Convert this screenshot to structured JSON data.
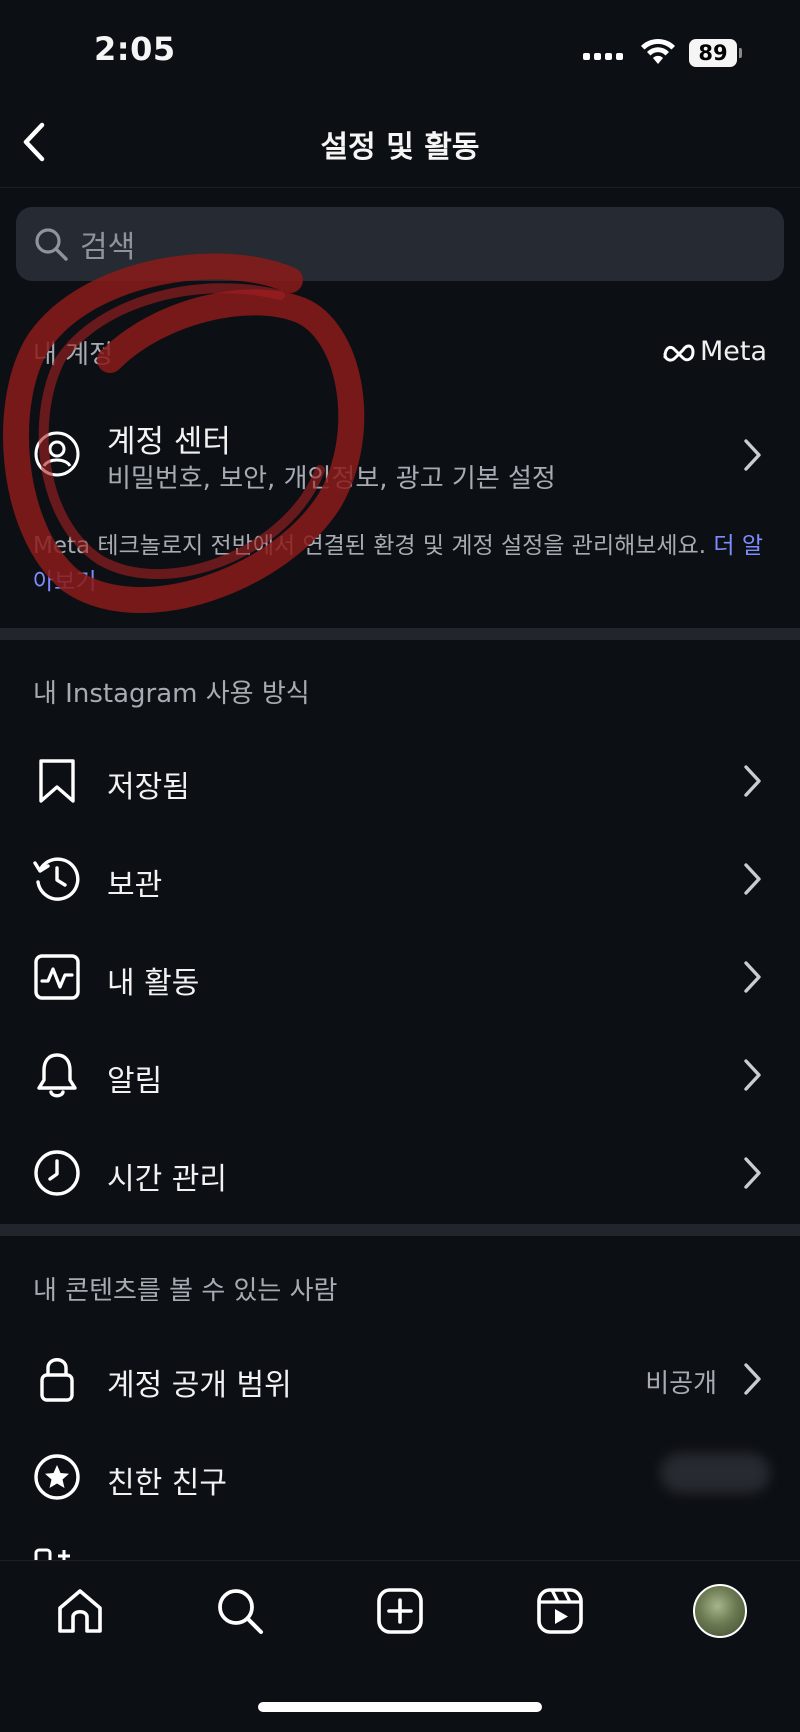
{
  "status": {
    "time": "2:05",
    "battery": "89"
  },
  "header": {
    "title": "설정 및 활동"
  },
  "search": {
    "placeholder": "검색"
  },
  "account_section": {
    "label": "내 계정",
    "brand": "Meta",
    "center": {
      "title": "계정 센터",
      "subtitle": "비밀번호, 보안, 개인정보, 광고 기본 설정"
    },
    "description": "Meta 테크놀로지 전반에서 연결된 환경 및 계정 설정을 관리해보세요.",
    "learn_more": "더 알아보기"
  },
  "usage_section": {
    "label": "내 Instagram 사용 방식",
    "items": [
      {
        "label": "저장됨",
        "icon": "bookmark-icon"
      },
      {
        "label": "보관",
        "icon": "archive-history-icon"
      },
      {
        "label": "내 활동",
        "icon": "activity-icon"
      },
      {
        "label": "알림",
        "icon": "bell-icon"
      },
      {
        "label": "시간 관리",
        "icon": "clock-icon"
      }
    ]
  },
  "content_section": {
    "label": "내 콘텐츠를 볼 수 있는 사람",
    "items": [
      {
        "label": "계정 공개 범위",
        "value": "비공개",
        "icon": "lock-icon"
      },
      {
        "label": "친한 친구",
        "icon": "star-circle-icon"
      }
    ]
  },
  "tabbar": {
    "items": [
      "home-icon",
      "search-icon",
      "create-icon",
      "reels-icon",
      "profile-avatar"
    ]
  },
  "colors": {
    "background": "#0c0f14",
    "link": "#7e8dff",
    "annotation": "#8b1a1a"
  }
}
